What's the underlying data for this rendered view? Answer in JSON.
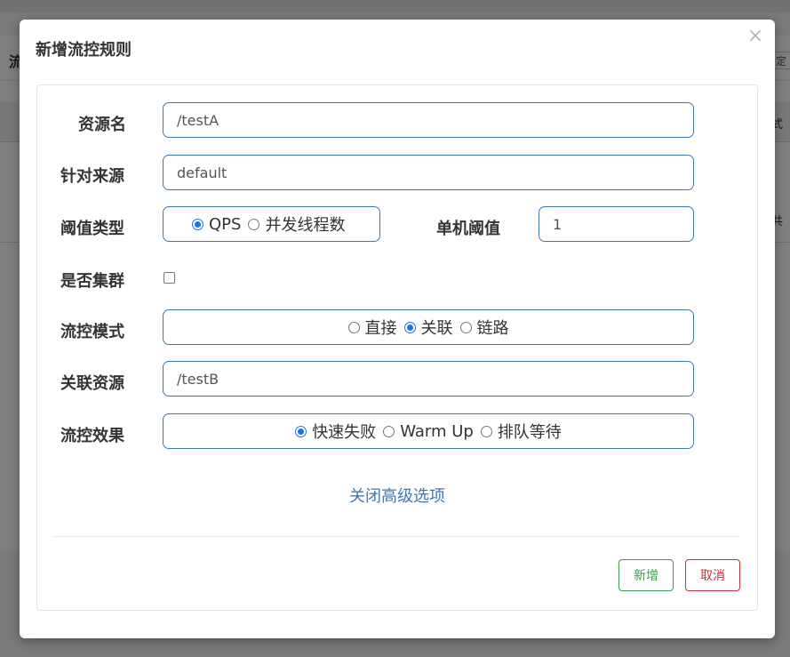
{
  "background": {
    "header_text": "流",
    "right_button": "定",
    "column_text": "式",
    "cell_text": "共"
  },
  "modal": {
    "title": "新增流控规则",
    "close_icon": "×"
  },
  "form": {
    "resource_name": {
      "label": "资源名",
      "value": "/testA"
    },
    "limit_app": {
      "label": "针对来源",
      "value": "default"
    },
    "threshold_type": {
      "label": "阈值类型",
      "options": [
        {
          "label": "QPS",
          "checked": true
        },
        {
          "label": "并发线程数",
          "checked": false
        }
      ]
    },
    "single_threshold": {
      "label": "单机阈值",
      "value": "1"
    },
    "cluster": {
      "label": "是否集群",
      "checked": false
    },
    "strategy": {
      "label": "流控模式",
      "options": [
        {
          "label": "直接",
          "checked": false
        },
        {
          "label": "关联",
          "checked": true
        },
        {
          "label": "链路",
          "checked": false
        }
      ]
    },
    "ref_resource": {
      "label": "关联资源",
      "value": "/testB"
    },
    "control_behavior": {
      "label": "流控效果",
      "options": [
        {
          "label": "快速失败",
          "checked": true
        },
        {
          "label": "Warm Up",
          "checked": false
        },
        {
          "label": "排队等待",
          "checked": false
        }
      ]
    },
    "advanced_toggle": "关闭高级选项"
  },
  "footer": {
    "add_label": "新增",
    "cancel_label": "取消"
  },
  "colors": {
    "accent": "#3e78b2",
    "radio_checked": "#1a73e8",
    "add_green": "#3a9d4a",
    "cancel_red": "#c9303a"
  }
}
